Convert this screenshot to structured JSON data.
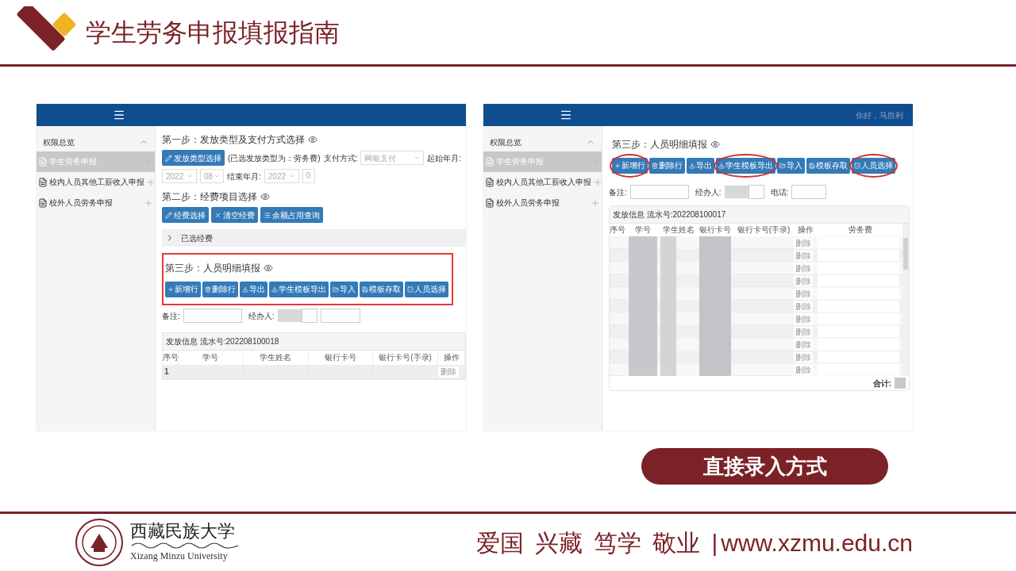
{
  "slide_title": "学生劳务申报填报指南",
  "left_screen": {
    "sidebar": {
      "header": "权限总览",
      "items": [
        {
          "label": "学生劳务申报",
          "selected": true
        },
        {
          "label": "校内人员其他工薪收入申报",
          "selected": false
        },
        {
          "label": "校外人员劳务申报",
          "selected": false
        }
      ]
    },
    "step1": {
      "title": "第一步：发放类型及支付方式选择",
      "button": "发放类型选择",
      "note": "(已选发放类型为：劳务费)",
      "pay_label": "支付方式:",
      "pay_value": "网银支付",
      "start_label": "起始年月:",
      "start_year": "2022",
      "start_month": "08",
      "end_label": "结束年月:",
      "end_year": "2022",
      "end_month": "0"
    },
    "step2": {
      "title": "第二步：经费项目选择",
      "buttons": [
        "经费选择",
        "清空经费",
        "余额占用查询"
      ],
      "selected_funds": "已选经费"
    },
    "step3": {
      "title": "第三步：人员明细填报",
      "highlighted": true,
      "buttons": [
        {
          "label": "新增行",
          "circled": false
        },
        {
          "label": "删除行",
          "circled": false
        },
        {
          "label": "导出",
          "circled": false
        },
        {
          "label": "学生模板导出",
          "circled": false
        },
        {
          "label": "导入",
          "circled": false
        },
        {
          "label": "模板存取",
          "circled": false
        },
        {
          "label": "人员选择",
          "circled": false
        }
      ],
      "remark_label": "备注:",
      "handler_label": "经办人:"
    },
    "table": {
      "caption": "发放信息 流水号:202208100018",
      "columns": [
        "序号",
        "学号",
        "学生姓名",
        "银行卡号",
        "银行卡号(手录)",
        "操作"
      ],
      "rows": [
        {
          "index": "1",
          "action": "删除"
        }
      ]
    }
  },
  "right_screen": {
    "greeting": "你好，马胜利",
    "sidebar": {
      "header": "权限总览",
      "items": [
        {
          "label": "学生劳务申报",
          "selected": true
        },
        {
          "label": "校内人员其他工薪收入申报",
          "selected": false
        },
        {
          "label": "校外人员劳务申报",
          "selected": false
        }
      ]
    },
    "step3": {
      "title": "第三步：人员明细填报",
      "highlighted": false,
      "buttons": [
        {
          "label": "新增行",
          "circled": true
        },
        {
          "label": "删除行",
          "circled": false
        },
        {
          "label": "导出",
          "circled": false
        },
        {
          "label": "学生模板导出",
          "circled": true
        },
        {
          "label": "导入",
          "circled": false
        },
        {
          "label": "模板存取",
          "circled": false
        },
        {
          "label": "人员选择",
          "circled": true
        }
      ],
      "remark_label": "备注:",
      "handler_label": "经办人:",
      "phone_label": "电话:"
    },
    "table": {
      "caption": "发放信息 流水号:202208100017",
      "columns": [
        "序号",
        "学号",
        "学生姓名",
        "银行卡号",
        "银行卡号(手录)",
        "操作",
        "劳务费"
      ],
      "rows": [
        {
          "action": "删除"
        },
        {
          "action": "删除"
        },
        {
          "action": "删除"
        },
        {
          "action": "删除"
        },
        {
          "action": "删除"
        },
        {
          "action": "删除"
        },
        {
          "action": "删除"
        },
        {
          "action": "删除"
        },
        {
          "action": "删除"
        },
        {
          "action": "删除"
        },
        {
          "action": "删除"
        }
      ],
      "total_label": "合计:"
    }
  },
  "callout": "直接录入方式",
  "footer": {
    "university_name": "西藏民族大学",
    "university_english": "Xizang Minzu University",
    "motto": [
      "爱国",
      "兴藏",
      "笃学",
      "敬业"
    ],
    "separator": "|",
    "url": "www.xzmu.edu.cn"
  }
}
